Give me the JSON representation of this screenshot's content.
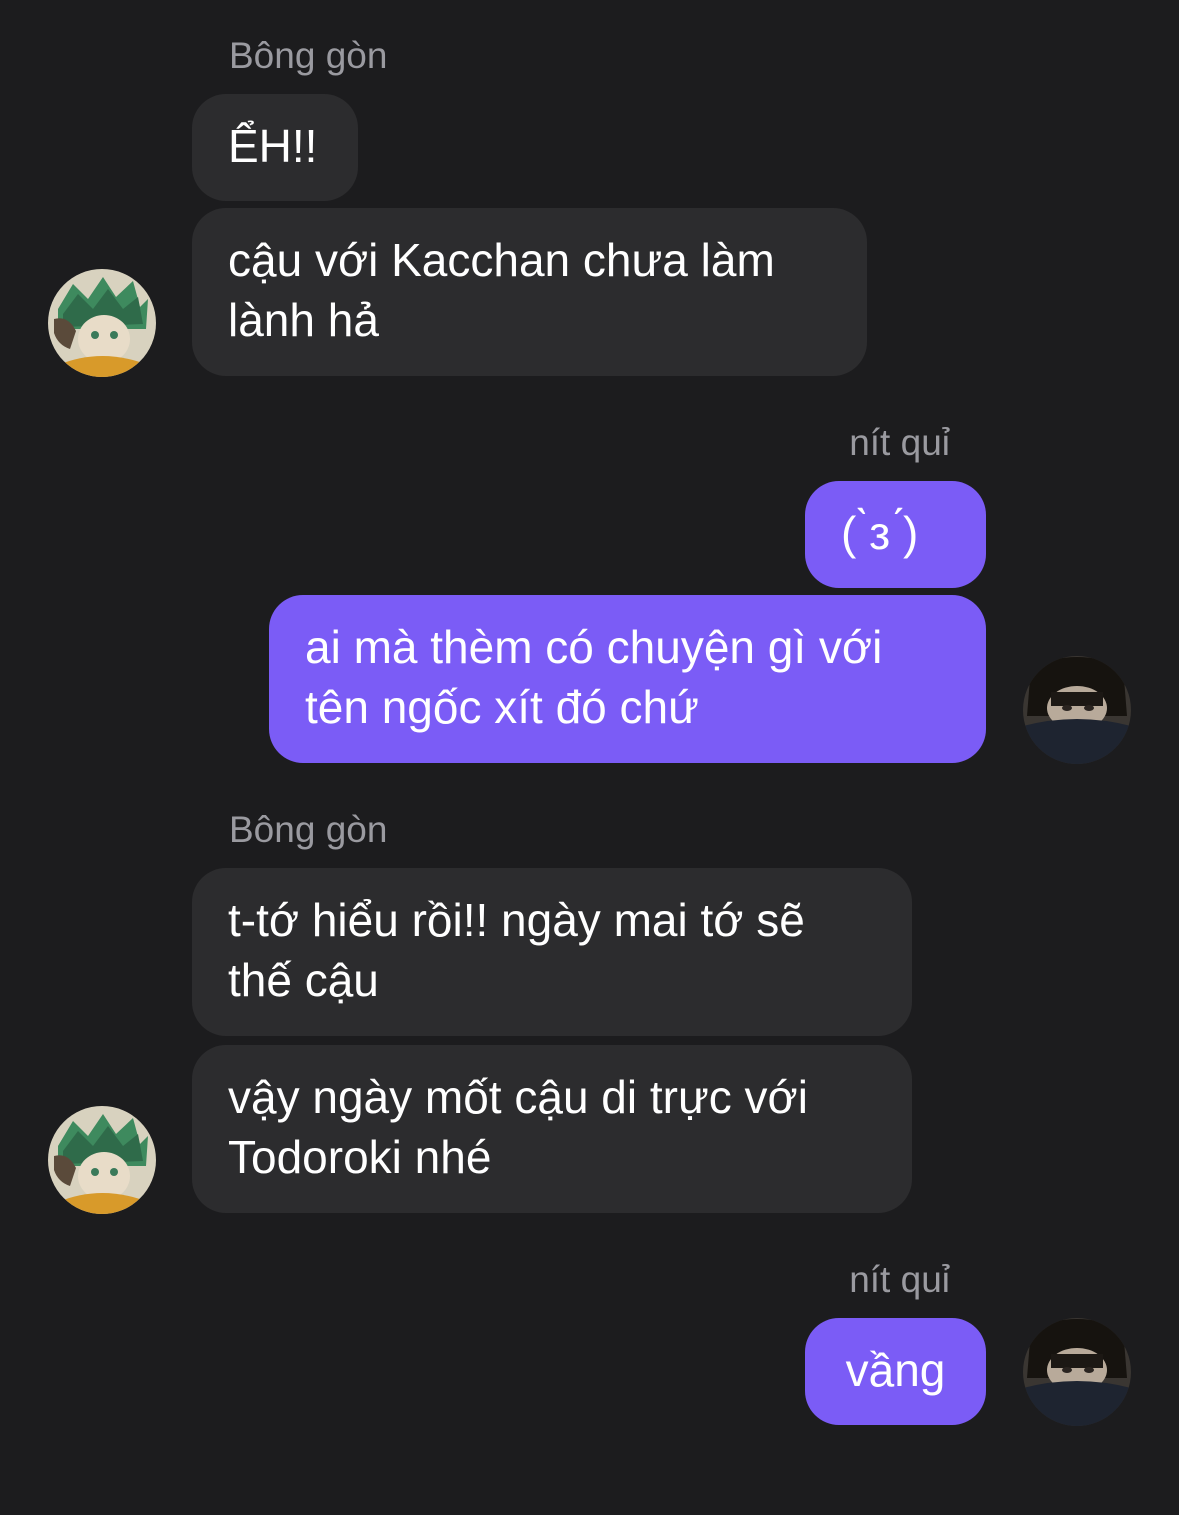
{
  "colors": {
    "background": "#1c1c1e",
    "incoming_bubble": "#2c2c2e",
    "outgoing_bubble": "#7b5cf6",
    "sender_name": "#9a9aa0"
  },
  "groups": [
    {
      "sender": "Bông gòn",
      "direction": "incoming",
      "avatar": "anime-boy-avatar-icon",
      "messages": [
        "ỂH!!",
        "cậu với Kacchan chưa làm lành hả"
      ]
    },
    {
      "sender": "nít quỉ",
      "direction": "outgoing",
      "avatar": "user-photo-avatar-icon",
      "messages": [
        "( ̀з ́)",
        "ai mà thèm có chuyện gì với tên ngốc xít đó chứ"
      ]
    },
    {
      "sender": "Bông gòn",
      "direction": "incoming",
      "avatar": "anime-boy-avatar-icon",
      "messages": [
        "t-tớ hiểu rồi!! ngày mai tớ sẽ thế cậu",
        "vậy ngày mốt cậu di trực với Todoroki nhé"
      ]
    },
    {
      "sender": "nít quỉ",
      "direction": "outgoing",
      "avatar": "user-photo-avatar-icon",
      "messages": [
        "vầng"
      ]
    }
  ]
}
